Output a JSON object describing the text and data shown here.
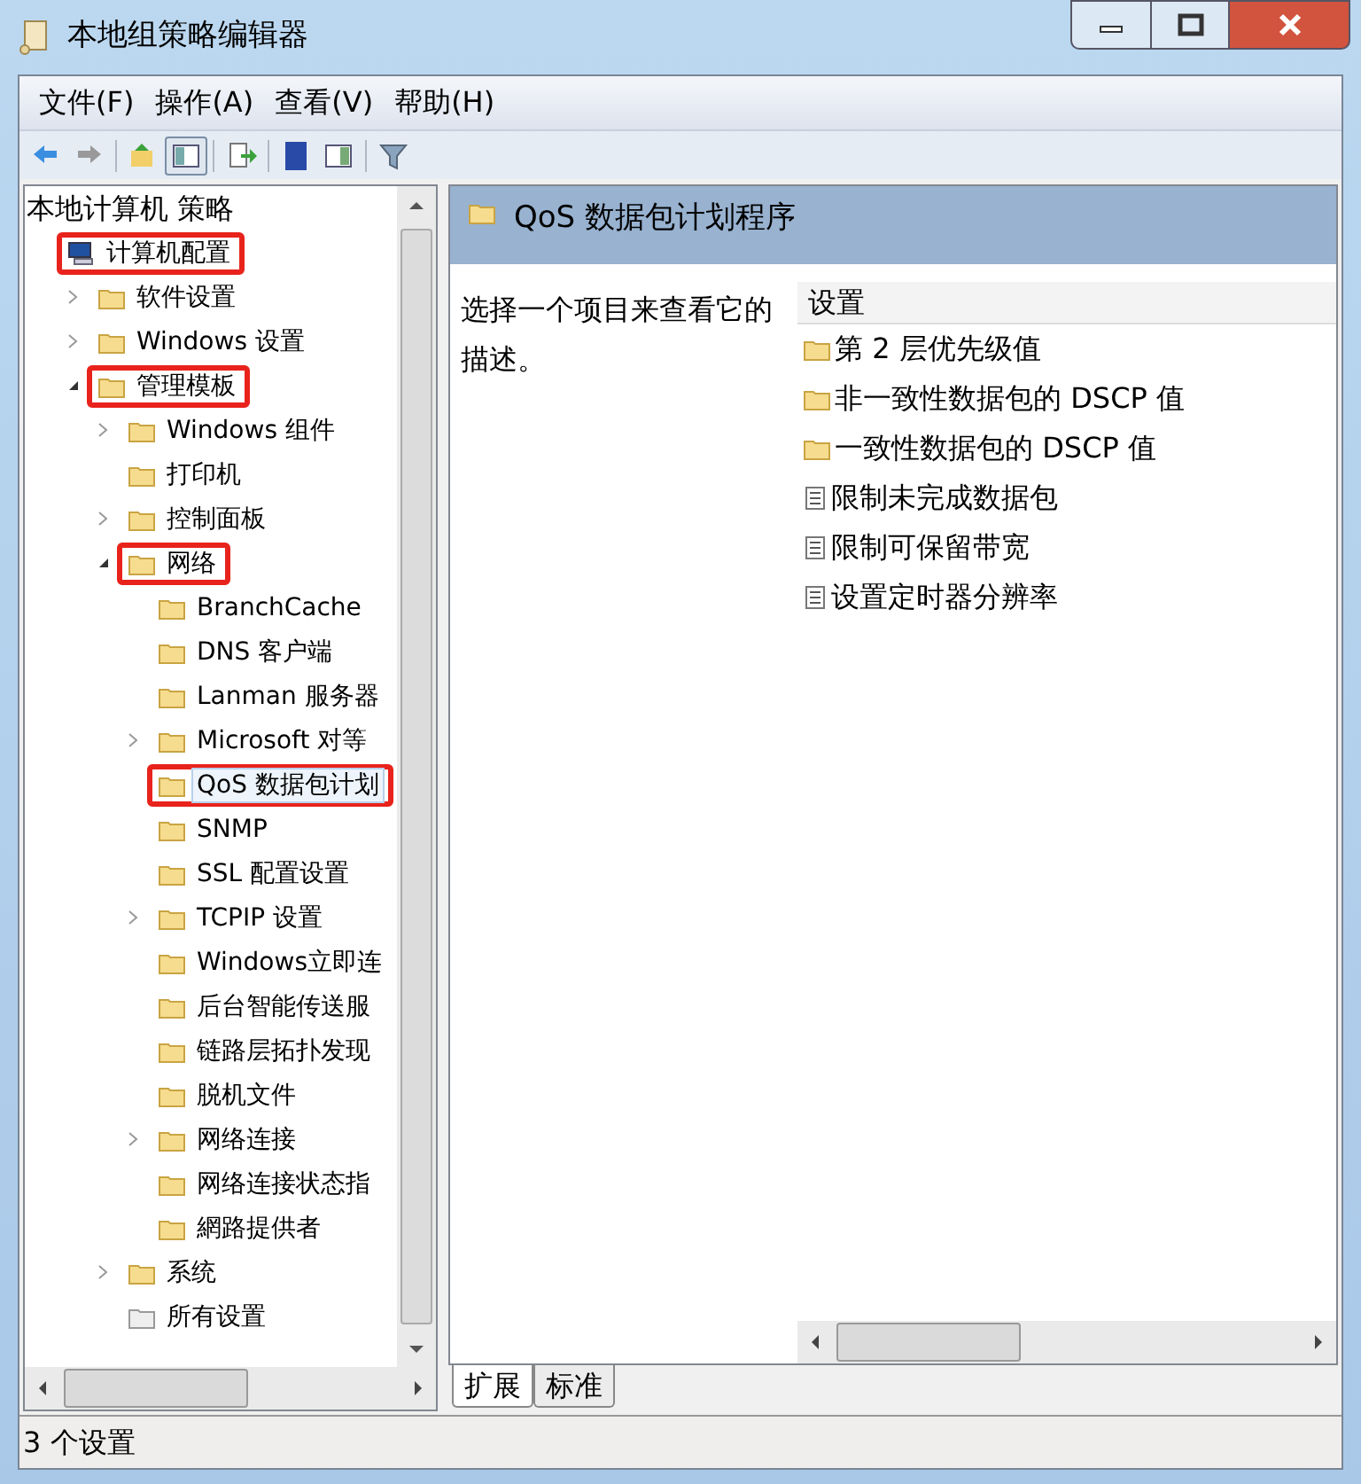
{
  "window": {
    "title": "本地组策略编辑器"
  },
  "menu": [
    "文件(F)",
    "操作(A)",
    "查看(V)",
    "帮助(H)"
  ],
  "toolbar": [
    {
      "kind": "back"
    },
    {
      "kind": "forward"
    },
    {
      "kind": "sep"
    },
    {
      "kind": "up"
    },
    {
      "kind": "tree",
      "selected": true
    },
    {
      "kind": "sep"
    },
    {
      "kind": "export"
    },
    {
      "kind": "sep"
    },
    {
      "kind": "help"
    },
    {
      "kind": "pane",
      "selected": false
    },
    {
      "kind": "sep"
    },
    {
      "kind": "filter"
    }
  ],
  "tree": {
    "root": "本地计算机 策略",
    "items": [
      {
        "label": "计算机配置",
        "kind": "computer",
        "annotated": true,
        "selected": false,
        "children": [
          {
            "label": "软件设置",
            "kind": "folder",
            "expanded": false,
            "annotated": false,
            "selected": false
          },
          {
            "label": "Windows 设置",
            "kind": "folder",
            "expanded": false,
            "annotated": false,
            "selected": false
          },
          {
            "label": "管理模板",
            "kind": "folder",
            "expanded": true,
            "annotated": true,
            "selected": false,
            "children": [
              {
                "label": "Windows 组件",
                "kind": "folder",
                "expanded": false,
                "annotated": false,
                "selected": false
              },
              {
                "label": "打印机",
                "kind": "folder",
                "annotated": false,
                "selected": false
              },
              {
                "label": "控制面板",
                "kind": "folder",
                "expanded": false,
                "annotated": false,
                "selected": false
              },
              {
                "label": "网络",
                "kind": "folder",
                "expanded": true,
                "annotated": true,
                "selected": false,
                "children": [
                  {
                    "label": "BranchCache",
                    "kind": "folder",
                    "annotated": false,
                    "selected": false
                  },
                  {
                    "label": "DNS 客户端",
                    "kind": "folder",
                    "annotated": false,
                    "selected": false
                  },
                  {
                    "label": "Lanman 服务器",
                    "kind": "folder",
                    "annotated": false,
                    "selected": false
                  },
                  {
                    "label": "Microsoft 对等",
                    "kind": "folder",
                    "expanded": false,
                    "annotated": false,
                    "selected": false
                  },
                  {
                    "label": "QoS 数据包计划",
                    "kind": "folder",
                    "annotated": true,
                    "selected": true
                  },
                  {
                    "label": "SNMP",
                    "kind": "folder",
                    "annotated": false,
                    "selected": false
                  },
                  {
                    "label": "SSL 配置设置",
                    "kind": "folder",
                    "annotated": false,
                    "selected": false
                  },
                  {
                    "label": "TCPIP 设置",
                    "kind": "folder",
                    "expanded": false,
                    "annotated": false,
                    "selected": false
                  },
                  {
                    "label": "Windows立即连",
                    "kind": "folder",
                    "annotated": false,
                    "selected": false
                  },
                  {
                    "label": "后台智能传送服",
                    "kind": "folder",
                    "annotated": false,
                    "selected": false
                  },
                  {
                    "label": "链路层拓扑发现",
                    "kind": "folder",
                    "annotated": false,
                    "selected": false
                  },
                  {
                    "label": "脱机文件",
                    "kind": "folder",
                    "annotated": false,
                    "selected": false
                  },
                  {
                    "label": "网络连接",
                    "kind": "folder",
                    "expanded": false,
                    "annotated": false,
                    "selected": false
                  },
                  {
                    "label": "网络连接状态指",
                    "kind": "folder",
                    "annotated": false,
                    "selected": false
                  },
                  {
                    "label": "網路提供者",
                    "kind": "folder",
                    "annotated": false,
                    "selected": false
                  }
                ]
              },
              {
                "label": "系统",
                "kind": "folder",
                "expanded": false,
                "annotated": false,
                "selected": false
              },
              {
                "label": "所有设置",
                "kind": "settings-folder",
                "annotated": false,
                "selected": false
              }
            ]
          }
        ]
      }
    ]
  },
  "detail": {
    "title": "QoS 数据包计划程序",
    "description": "选择一个项目来查看它的描述。",
    "column": "设置",
    "items": [
      {
        "kind": "folder",
        "label": "第 2 层优先级值"
      },
      {
        "kind": "folder",
        "label": "非一致性数据包的 DSCP 值"
      },
      {
        "kind": "folder",
        "label": "一致性数据包的 DSCP 值"
      },
      {
        "kind": "setting",
        "label": "限制未完成数据包"
      },
      {
        "kind": "setting",
        "label": "限制可保留带宽"
      },
      {
        "kind": "setting",
        "label": "设置定时器分辨率"
      }
    ]
  },
  "tabs": [
    {
      "label": "扩展",
      "selected": true
    },
    {
      "label": "标准",
      "selected": false
    }
  ],
  "status_bar": "3 个设置"
}
